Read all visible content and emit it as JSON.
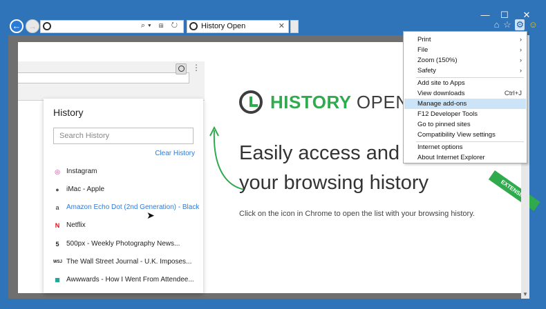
{
  "window": {
    "minimize": "—",
    "maximize": "☐",
    "close": "✕"
  },
  "toolbar": {
    "back": "←",
    "forward": "→",
    "address_tools": "⌕▾ ⊞ ↻",
    "tab_title": "History Open",
    "tab_close": "✕",
    "right_icons": {
      "home": "⌂",
      "star": "☆",
      "gear": "⚙",
      "smiley": "☺"
    }
  },
  "chrome_mock": {
    "popup_title": "History",
    "search_placeholder": "Search History",
    "clear_label": "Clear History",
    "items": [
      {
        "icon": "instagram-icon",
        "glyph": "◎",
        "color": "#c13584",
        "label": "Instagram"
      },
      {
        "icon": "apple-icon",
        "glyph": "●",
        "color": "#555555",
        "label": "iMac - Apple"
      },
      {
        "icon": "amazon-icon",
        "glyph": "a",
        "color": "#222222",
        "label": "Amazon Echo Dot (2nd Generation) - Black"
      },
      {
        "icon": "netflix-icon",
        "glyph": "N",
        "color": "#e50914",
        "label": "Netflix"
      },
      {
        "icon": "500px-icon",
        "glyph": "5",
        "color": "#222222",
        "label": "500px - Weekly Photography News..."
      },
      {
        "icon": "wsj-icon",
        "glyph": "WSJ",
        "color": "#222222",
        "label": "The Wall Street Journal - U.K. Imposes..."
      },
      {
        "icon": "awwwards-icon",
        "glyph": "■",
        "color": "#26a69a",
        "label": "Awwwards - How I Went From Attendee..."
      }
    ]
  },
  "hero": {
    "logo_brand": "HISTORY",
    "logo_open": "OPEN",
    "headline_1": "Easily access and",
    "headline_2": "your browsing history",
    "subtext": "Click on the icon in Chrome to open the list with your browsing history.",
    "ribbon": "EXTENSION"
  },
  "menu": {
    "items": [
      {
        "label": "Print",
        "shortcut": "›"
      },
      {
        "label": "File",
        "shortcut": "›"
      },
      {
        "label": "Zoom (150%)",
        "shortcut": "›"
      },
      {
        "label": "Safety",
        "shortcut": "›"
      },
      {
        "label": "Add site to Apps",
        "shortcut": ""
      },
      {
        "label": "View downloads",
        "shortcut": "Ctrl+J"
      },
      {
        "label": "Manage add-ons",
        "shortcut": ""
      },
      {
        "label": "F12 Developer Tools",
        "shortcut": ""
      },
      {
        "label": "Go to pinned sites",
        "shortcut": ""
      },
      {
        "label": "Compatibility View settings",
        "shortcut": ""
      },
      {
        "label": "Internet options",
        "shortcut": ""
      },
      {
        "label": "About Internet Explorer",
        "shortcut": ""
      }
    ],
    "highlighted_index": 6
  },
  "colors": {
    "accent": "#2faa4d",
    "menu_highlight": "#cce4f7",
    "link": "#2f7ad8",
    "frame": "#2f74b8"
  }
}
